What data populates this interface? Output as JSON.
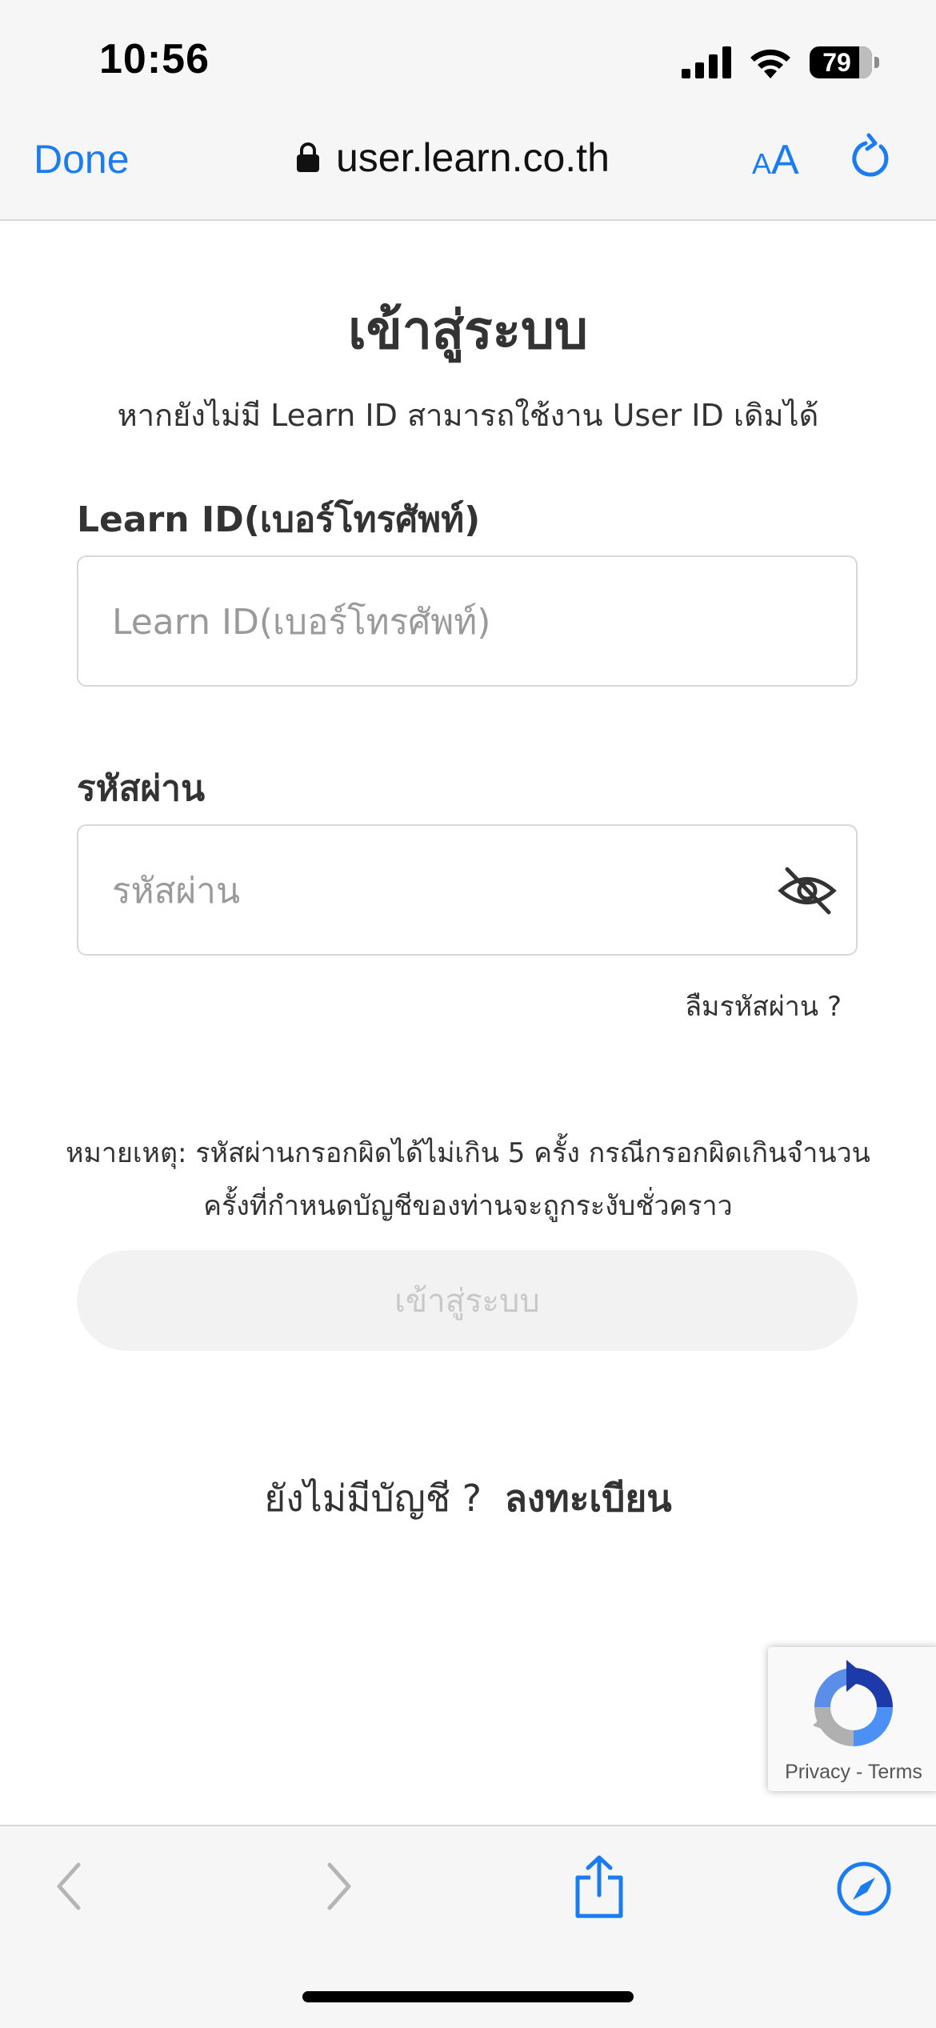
{
  "status_bar": {
    "time": "10:56",
    "battery": "79"
  },
  "browser": {
    "done_label": "Done",
    "url": "user.learn.co.th",
    "text_size_small": "A",
    "text_size_big": "A",
    "accent_color": "#1a7cf0"
  },
  "page": {
    "title": "เข้าสู่ระบบ",
    "subtitle": "หากยังไม่มี Learn ID สามารถใช้งาน User ID เดิมได้",
    "learn_id": {
      "label": "Learn ID(เบอร์โทรศัพท์)",
      "placeholder": "Learn ID(เบอร์โทรศัพท์)",
      "value": ""
    },
    "password": {
      "label": "รหัสผ่าน",
      "placeholder": "รหัสผ่าน",
      "value": "",
      "toggle_icon": "eye-slash-icon"
    },
    "forgot_password": "ลืมรหัสผ่าน ?",
    "note_line1": "หมายเหตุ: รหัสผ่านกรอกผิดได้ไม่เกิน 5 ครั้ง กรณีกรอกผิดเกินจำนวน",
    "note_line2": "ครั้งที่กำหนดบัญชีของท่านจะถูกระงับชั่วคราว",
    "login_button": "เข้าสู่ระบบ",
    "no_account": "ยังไม่มีบัญชี ?",
    "register": "ลงทะเบียน"
  },
  "recaptcha": {
    "privacy": "Privacy",
    "separator": "-",
    "terms": "Terms"
  },
  "toolbar": {
    "icons": [
      "back-icon",
      "forward-icon",
      "share-icon",
      "compass-icon"
    ]
  }
}
